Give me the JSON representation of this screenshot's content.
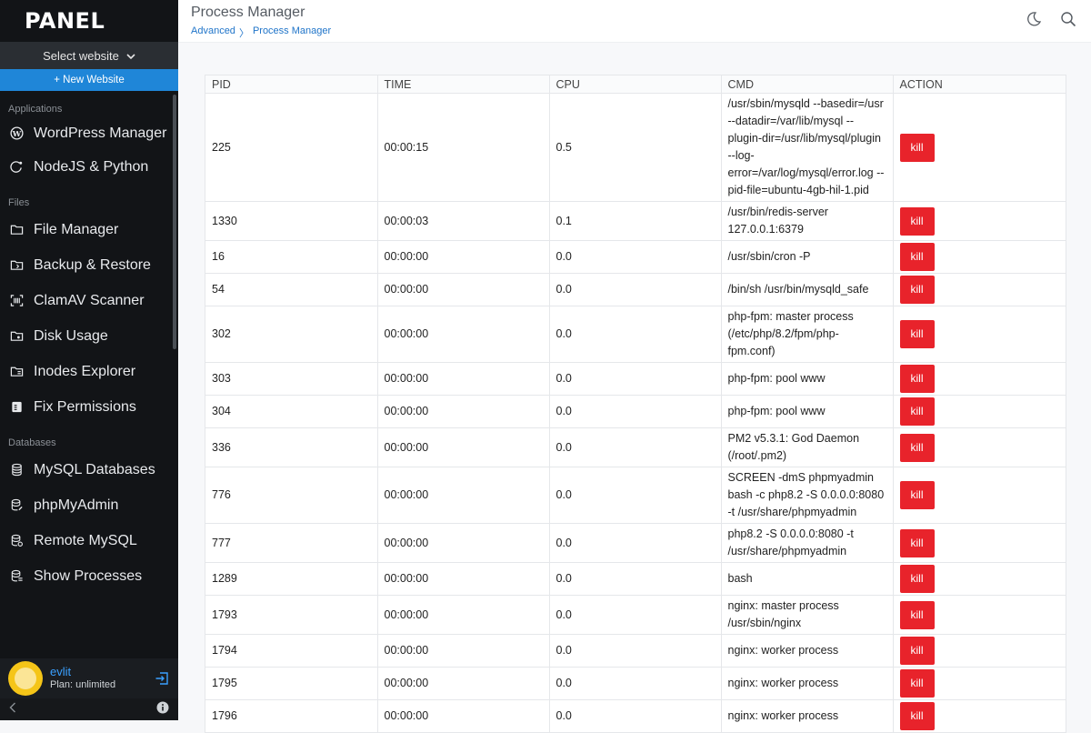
{
  "sidebar": {
    "logo": "PANEL",
    "select_website": "Select website",
    "new_website": "+ New Website",
    "sections": {
      "applications": "Applications",
      "files": "Files",
      "databases": "Databases"
    },
    "items": {
      "wordpress": "WordPress Manager",
      "nodejs": "NodeJS & Python",
      "file_manager": "File Manager",
      "backup": "Backup & Restore",
      "clamav": "ClamAV Scanner",
      "disk": "Disk Usage",
      "inodes": "Inodes Explorer",
      "fix_permissions": "Fix Permissions",
      "mysql_databases": "MySQL Databases",
      "phpmyadmin": "phpMyAdmin",
      "remote_mysql": "Remote MySQL",
      "show_processes": "Show Processes"
    },
    "user": {
      "name": "evlit",
      "plan": "Plan: unlimited"
    }
  },
  "header": {
    "title": "Process Manager",
    "breadcrumb": [
      "Advanced",
      "〉",
      "Process Manager"
    ]
  },
  "table": {
    "columns": [
      "PID",
      "TIME",
      "CPU",
      "CMD",
      "ACTION"
    ],
    "kill_label": "kill",
    "rows": [
      {
        "pid": "225",
        "time": "00:00:15",
        "cpu": "0.5",
        "cmd": "/usr/sbin/mysqld --basedir=/usr --datadir=/var/lib/mysql --plugin-dir=/usr/lib/mysql/plugin --log-error=/var/log/mysql/error.log --pid-file=ubuntu-4gb-hil-1.pid"
      },
      {
        "pid": "1330",
        "time": "00:00:03",
        "cpu": "0.1",
        "cmd": "/usr/bin/redis-server 127.0.0.1:6379"
      },
      {
        "pid": "16",
        "time": "00:00:00",
        "cpu": "0.0",
        "cmd": "/usr/sbin/cron -P"
      },
      {
        "pid": "54",
        "time": "00:00:00",
        "cpu": "0.0",
        "cmd": "/bin/sh /usr/bin/mysqld_safe"
      },
      {
        "pid": "302",
        "time": "00:00:00",
        "cpu": "0.0",
        "cmd": "php-fpm: master process (/etc/php/8.2/fpm/php-fpm.conf)"
      },
      {
        "pid": "303",
        "time": "00:00:00",
        "cpu": "0.0",
        "cmd": "php-fpm: pool www"
      },
      {
        "pid": "304",
        "time": "00:00:00",
        "cpu": "0.0",
        "cmd": "php-fpm: pool www"
      },
      {
        "pid": "336",
        "time": "00:00:00",
        "cpu": "0.0",
        "cmd": "PM2 v5.3.1: God Daemon (/root/.pm2)"
      },
      {
        "pid": "776",
        "time": "00:00:00",
        "cpu": "0.0",
        "cmd": "SCREEN -dmS phpmyadmin bash -c php8.2 -S 0.0.0.0:8080 -t /usr/share/phpmyadmin"
      },
      {
        "pid": "777",
        "time": "00:00:00",
        "cpu": "0.0",
        "cmd": "php8.2 -S 0.0.0.0:8080 -t /usr/share/phpmyadmin"
      },
      {
        "pid": "1289",
        "time": "00:00:00",
        "cpu": "0.0",
        "cmd": "bash"
      },
      {
        "pid": "1793",
        "time": "00:00:00",
        "cpu": "0.0",
        "cmd": "nginx: master process /usr/sbin/nginx"
      },
      {
        "pid": "1794",
        "time": "00:00:00",
        "cpu": "0.0",
        "cmd": "nginx: worker process"
      },
      {
        "pid": "1795",
        "time": "00:00:00",
        "cpu": "0.0",
        "cmd": "nginx: worker process"
      },
      {
        "pid": "1796",
        "time": "00:00:00",
        "cpu": "0.0",
        "cmd": "nginx: worker process"
      }
    ]
  },
  "colors": {
    "sidebar_bg": "#121417",
    "accent": "#1f86d8",
    "kill_button": "#e8232b"
  }
}
